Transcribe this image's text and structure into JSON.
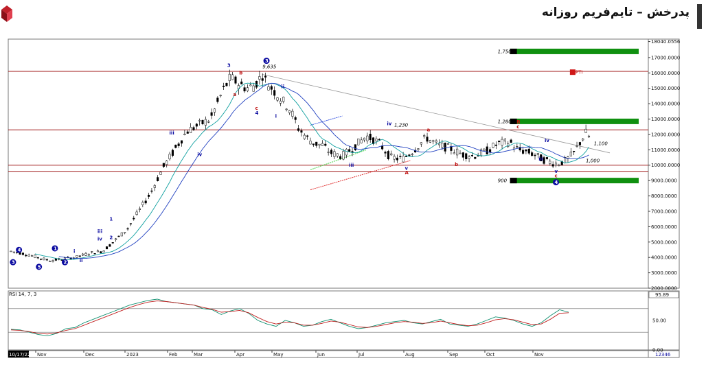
{
  "header": {
    "title": "پدرخش – تایم‌فریم روزانه"
  },
  "chart_data": [
    {
      "type": "candlestick",
      "title": "",
      "y_axis": {
        "ticks": [
          "2000.0000",
          "3000.0000",
          "4000.0000",
          "5000.0000",
          "6000.0000",
          "7000.0000",
          "8000.0000",
          "9000.0000",
          "10000.0000",
          "11000.0000",
          "12000.0000",
          "13000.0000",
          "14000.0000",
          "15000.0000",
          "16000.0000",
          "17000.0000",
          "18040.0556"
        ],
        "ylim": [
          2000,
          18200
        ],
        "last_price_label": "12346"
      },
      "x_axis": {
        "ticks": [
          "10/17/22",
          "Nov",
          "Dec",
          "2023",
          "Feb",
          "Mar",
          "Apr",
          "May",
          "Jun",
          "Jul",
          "Aug",
          "Sep",
          "Oct",
          "Nov"
        ]
      },
      "close_path": [
        [
          0,
          4400
        ],
        [
          8,
          4200
        ],
        [
          16,
          3900
        ],
        [
          20,
          3800
        ],
        [
          26,
          3900
        ],
        [
          32,
          4000
        ],
        [
          40,
          4300
        ],
        [
          46,
          4400
        ],
        [
          52,
          5100
        ],
        [
          58,
          5800
        ],
        [
          64,
          7000
        ],
        [
          70,
          8200
        ],
        [
          76,
          9800
        ],
        [
          82,
          11000
        ],
        [
          88,
          12200
        ],
        [
          94,
          12600
        ],
        [
          100,
          13000
        ],
        [
          106,
          14800
        ],
        [
          110,
          15700
        ],
        [
          114,
          15300
        ],
        [
          118,
          15000
        ],
        [
          122,
          15200
        ],
        [
          126,
          15900
        ],
        [
          128,
          15400
        ],
        [
          132,
          14800
        ],
        [
          136,
          14200
        ],
        [
          140,
          13600
        ],
        [
          144,
          12400
        ],
        [
          148,
          11800
        ],
        [
          152,
          11400
        ],
        [
          156,
          11300
        ],
        [
          160,
          10800
        ],
        [
          166,
          10600
        ],
        [
          172,
          11200
        ],
        [
          178,
          11900
        ],
        [
          184,
          11500
        ],
        [
          190,
          10500
        ],
        [
          196,
          10400
        ],
        [
          202,
          11000
        ],
        [
          208,
          11800
        ],
        [
          214,
          11300
        ],
        [
          220,
          11100
        ],
        [
          226,
          10700
        ],
        [
          232,
          10600
        ],
        [
          238,
          10900
        ],
        [
          244,
          11400
        ],
        [
          250,
          11500
        ],
        [
          254,
          11000
        ],
        [
          258,
          10900
        ],
        [
          262,
          10700
        ],
        [
          266,
          10400
        ],
        [
          270,
          10200
        ],
        [
          274,
          10100
        ],
        [
          278,
          10300
        ],
        [
          282,
          10800
        ],
        [
          286,
          11700
        ],
        [
          288,
          12100
        ],
        [
          290,
          11800
        ]
      ],
      "horizontal_levels": [
        16100,
        12300,
        10000,
        9600
      ],
      "trendline": {
        "from": [
          126,
          15900
        ],
        "to": [
          300,
          10800
        ]
      },
      "target_boxes": [
        {
          "label": "1,750",
          "value": 17400,
          "color": "#109010"
        },
        {
          "label": "1,280",
          "value": 12850,
          "color": "#109010"
        },
        {
          "label": "900",
          "value": 9000,
          "color": "#109010"
        }
      ],
      "price_annotations": [
        {
          "text": "9,635",
          "x": 126,
          "y": 16300
        },
        {
          "text": "1,230",
          "x": 192,
          "y": 12500
        },
        {
          "text": "1,100",
          "x": 292,
          "y": 11300
        },
        {
          "text": "1,000",
          "x": 288,
          "y": 10200
        }
      ],
      "wave_labels": [
        {
          "text": "3",
          "x": 1,
          "y": 3600,
          "color": "#0a0aa0",
          "circle": true
        },
        {
          "text": "4",
          "x": 4,
          "y": 4400,
          "color": "#0a0aa0",
          "circle": true
        },
        {
          "text": "5",
          "x": 14,
          "y": 3300,
          "color": "#0a0aa0",
          "circle": true
        },
        {
          "text": "1",
          "x": 22,
          "y": 4500,
          "color": "#0a0aa0",
          "circle": true
        },
        {
          "text": "2",
          "x": 27,
          "y": 3600,
          "color": "#0a0aa0",
          "circle": true
        },
        {
          "text": "i",
          "x": 32,
          "y": 4300,
          "color": "#0a0aa0",
          "circle": false
        },
        {
          "text": "ii",
          "x": 35,
          "y": 3700,
          "color": "#0a0aa0",
          "circle": false
        },
        {
          "text": "iii",
          "x": 44,
          "y": 5600,
          "color": "#0a0aa0",
          "circle": false
        },
        {
          "text": "iv",
          "x": 44,
          "y": 5100,
          "color": "#0a0aa0",
          "circle": false
        },
        {
          "text": "1",
          "x": 50,
          "y": 6400,
          "color": "#0a0aa0",
          "circle": false
        },
        {
          "text": "2",
          "x": 50,
          "y": 5200,
          "color": "#0a0aa0",
          "circle": false
        },
        {
          "text": "iii",
          "x": 80,
          "y": 12000,
          "color": "#0a0aa0",
          "circle": false
        },
        {
          "text": "iv",
          "x": 94,
          "y": 10600,
          "color": "#0a0aa0",
          "circle": false
        },
        {
          "text": "3",
          "x": 109,
          "y": 16400,
          "color": "#0a0aa0",
          "circle": false
        },
        {
          "text": "3",
          "x": 128,
          "y": 16700,
          "color": "#0a0aa0",
          "circle": true
        },
        {
          "text": "a",
          "x": 112,
          "y": 14500,
          "color": "#c01010",
          "circle": false
        },
        {
          "text": "b",
          "x": 115,
          "y": 15900,
          "color": "#c01010",
          "circle": false
        },
        {
          "text": "c",
          "x": 123,
          "y": 13600,
          "color": "#c01010",
          "circle": false
        },
        {
          "text": "4",
          "x": 123,
          "y": 13300,
          "color": "#0a0aa0",
          "circle": false
        },
        {
          "text": "ii",
          "x": 136,
          "y": 15000,
          "color": "#0a0aa0",
          "circle": false
        },
        {
          "text": "i",
          "x": 133,
          "y": 13100,
          "color": "#0a0aa0",
          "circle": false
        },
        {
          "text": "iii",
          "x": 170,
          "y": 9900,
          "color": "#0a0aa0",
          "circle": false
        },
        {
          "text": "iv",
          "x": 189,
          "y": 12600,
          "color": "#0a0aa0",
          "circle": false
        },
        {
          "text": "v",
          "x": 198,
          "y": 9700,
          "color": "#0a0aa0",
          "circle": false
        },
        {
          "text": "A",
          "x": 198,
          "y": 9400,
          "color": "#c01010",
          "circle": false
        },
        {
          "text": "a",
          "x": 209,
          "y": 12200,
          "color": "#c01010",
          "circle": false
        },
        {
          "text": "b",
          "x": 223,
          "y": 9950,
          "color": "#c01010",
          "circle": false
        },
        {
          "text": "B",
          "x": 254,
          "y": 12700,
          "color": "#c01010",
          "circle": false
        },
        {
          "text": "c",
          "x": 254,
          "y": 12400,
          "color": "#c01010",
          "circle": false
        },
        {
          "text": "iv",
          "x": 268,
          "y": 11500,
          "color": "#0a0aa0",
          "circle": false
        },
        {
          "text": "iii",
          "x": 265,
          "y": 10300,
          "color": "#0a0aa0",
          "circle": false
        },
        {
          "text": "v",
          "x": 273,
          "y": 9500,
          "color": "#0a0aa0",
          "circle": false
        },
        {
          "text": "c",
          "x": 273,
          "y": 9200,
          "color": "#c01010",
          "circle": false
        },
        {
          "text": "4",
          "x": 273,
          "y": 8800,
          "color": "#0a0aa0",
          "circle": true
        }
      ],
      "tag_label": {
        "text": "PTI",
        "value": 16050
      }
    },
    {
      "type": "line",
      "title": "RSI 14, 7, 3",
      "ylim": [
        0,
        100
      ],
      "y_axis": {
        "ticks": [
          "0.00",
          "50.00"
        ],
        "current": "95.89"
      },
      "levels": [
        70,
        30
      ],
      "series": [
        {
          "color": "#109070",
          "values": [
            35,
            34,
            30,
            26,
            24,
            28,
            36,
            38,
            46,
            52,
            58,
            64,
            70,
            76,
            80,
            84,
            86,
            82,
            80,
            78,
            76,
            70,
            68,
            60,
            66,
            70,
            62,
            50,
            44,
            40,
            50,
            46,
            40,
            42,
            48,
            52,
            46,
            40,
            36,
            38,
            42,
            46,
            48,
            50,
            46,
            44,
            48,
            52,
            44,
            42,
            40,
            44,
            50,
            56,
            54,
            50,
            44,
            40,
            46,
            58,
            68,
            64
          ]
        },
        {
          "color": "#c02020",
          "values": [
            34,
            33,
            31,
            28,
            27,
            29,
            33,
            36,
            42,
            48,
            54,
            60,
            66,
            72,
            77,
            81,
            83,
            82,
            80,
            78,
            76,
            72,
            69,
            64,
            65,
            67,
            63,
            55,
            48,
            44,
            47,
            46,
            42,
            42,
            45,
            49,
            47,
            43,
            39,
            38,
            40,
            43,
            46,
            48,
            47,
            45,
            46,
            49,
            46,
            43,
            41,
            42,
            46,
            51,
            53,
            51,
            47,
            43,
            44,
            52,
            62,
            63
          ]
        }
      ]
    }
  ]
}
